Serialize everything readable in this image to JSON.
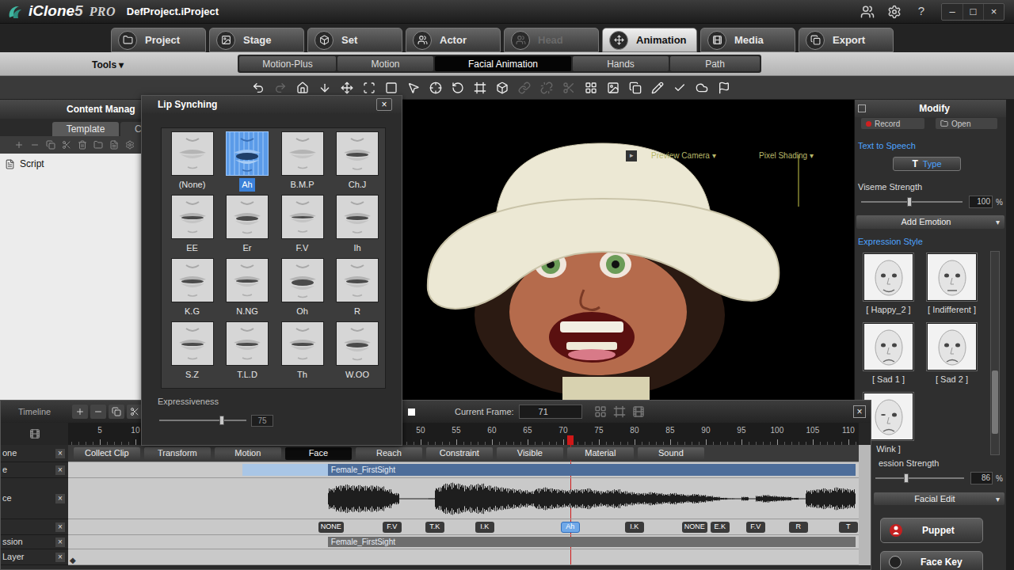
{
  "window": {
    "logo": {
      "name": "iClone",
      "version": "5",
      "edition": "PRO"
    },
    "project": "DefProject.iProject",
    "buttons": [
      "?",
      "–",
      "□",
      "×"
    ]
  },
  "main_tabs": [
    {
      "label": "Project",
      "selected": false,
      "disabled": false
    },
    {
      "label": "Stage",
      "selected": false,
      "disabled": false
    },
    {
      "label": "Set",
      "selected": false,
      "disabled": false
    },
    {
      "label": "Actor",
      "selected": false,
      "disabled": false
    },
    {
      "label": "Head",
      "selected": false,
      "disabled": true
    },
    {
      "label": "Animation",
      "selected": true,
      "disabled": false
    },
    {
      "label": "Media",
      "selected": false,
      "disabled": false
    },
    {
      "label": "Export",
      "selected": false,
      "disabled": false
    }
  ],
  "tools_menu": "Tools ▾",
  "sub_tabs": [
    {
      "label": "Motion-Plus",
      "selected": false
    },
    {
      "label": "Motion",
      "selected": false
    },
    {
      "label": "Facial Animation",
      "selected": true
    },
    {
      "label": "Hands",
      "selected": false
    },
    {
      "label": "Path",
      "selected": false
    }
  ],
  "toolbar": [
    {
      "disabled": false
    },
    {
      "disabled": true
    },
    {
      "disabled": false
    },
    {
      "disabled": false
    },
    {
      "disabled": false
    },
    {
      "disabled": false
    },
    {
      "disabled": false
    },
    {
      "disabled": false
    },
    {
      "disabled": false
    },
    {
      "disabled": false
    },
    {
      "disabled": false
    },
    {
      "disabled": false
    },
    {
      "disabled": true
    },
    {
      "disabled": true
    },
    {
      "disabled": true
    },
    {
      "disabled": false
    },
    {
      "disabled": false
    },
    {
      "disabled": false
    },
    {
      "disabled": false
    },
    {
      "disabled": false
    },
    {
      "disabled": false
    },
    {
      "disabled": false
    }
  ],
  "content_manager": {
    "title": "Content Manag",
    "tabs": [
      {
        "label": "Template",
        "selected": true
      },
      {
        "label": "C",
        "selected": false
      }
    ],
    "items": [
      {
        "label": "Script",
        "selected": false
      }
    ]
  },
  "lip_sync": {
    "title": "Lip Synching",
    "close": "×",
    "visemes": [
      {
        "label": "(None)",
        "selected": false
      },
      {
        "label": "Ah",
        "selected": true
      },
      {
        "label": "B.M.P",
        "selected": false
      },
      {
        "label": "Ch.J",
        "selected": false
      },
      {
        "label": "EE",
        "selected": false
      },
      {
        "label": "Er",
        "selected": false
      },
      {
        "label": "F.V",
        "selected": false
      },
      {
        "label": "Ih",
        "selected": false
      },
      {
        "label": "K.G",
        "selected": false
      },
      {
        "label": "N.NG",
        "selected": false
      },
      {
        "label": "Oh",
        "selected": false
      },
      {
        "label": "R",
        "selected": false
      },
      {
        "label": "S.Z",
        "selected": false
      },
      {
        "label": "T.L.D",
        "selected": false
      },
      {
        "label": "Th",
        "selected": false
      },
      {
        "label": "W.OO",
        "selected": false
      }
    ],
    "expressiveness": {
      "label": "Expressiveness",
      "level": 0.72,
      "value": "75"
    }
  },
  "viewport": {
    "arrow": "▸",
    "camera": "Preview Camera ▾",
    "shading": "Pixel Shading ▾"
  },
  "modify": {
    "title": "Modify",
    "record": "Record",
    "open": "Open",
    "text_to_speech": "Text to Speech",
    "type_icon": "T",
    "type": "Type",
    "viseme_strength": {
      "label": "Viseme Strength",
      "level": 0.48,
      "value": "100",
      "unit": "%"
    },
    "add_emotion": "Add Emotion",
    "dropdown_glyph": "▾",
    "expression_style": "Expression Style",
    "expressions": [
      {
        "label": "[ Happy_2 ]",
        "selected": false
      },
      {
        "label": "[ Indifferent ]",
        "selected": false
      },
      {
        "label": "[ Sad 1 ]",
        "selected": false
      },
      {
        "label": "[ Sad 2 ]",
        "selected": false
      },
      {
        "label": "Wink ]",
        "selected": false
      }
    ],
    "expression_strength": {
      "label": "ession Strength",
      "level": 0.35,
      "value": "86",
      "unit": "%"
    },
    "facial_edit": "Facial Edit",
    "puppet": "Puppet",
    "face_key": "Face Key"
  },
  "timeline": {
    "title": "Timeline",
    "current_frame_label": "Current Frame:",
    "current_frame": "71",
    "close": "×",
    "ticks": [
      "5",
      "10",
      "50",
      "55",
      "60",
      "65",
      "70",
      "75",
      "80",
      "85",
      "90",
      "95",
      "100",
      "105",
      "110"
    ],
    "tracks": [
      {
        "label": "one",
        "kind": "buttons",
        "buttons": [
          {
            "label": "Collect Clip",
            "selected": false
          },
          {
            "label": "Transform",
            "selected": false
          },
          {
            "label": "Motion",
            "selected": false
          },
          {
            "label": "Face",
            "selected": true
          },
          {
            "label": "Reach",
            "selected": false
          },
          {
            "label": "Constraint",
            "selected": false
          },
          {
            "label": "Visible",
            "selected": false
          },
          {
            "label": "Material",
            "selected": false
          },
          {
            "label": "Sound",
            "selected": false
          }
        ]
      },
      {
        "label": "e",
        "kind": "clip",
        "range_start": 25,
        "clip": {
          "label": "Female_FirstSight",
          "start": 37,
          "end": 111,
          "color": "#4d6d9a"
        }
      },
      {
        "label": "ce",
        "kind": "wave",
        "start": 37,
        "levels": [
          0.55,
          0.7,
          0.75,
          0.7,
          0.72,
          0.68,
          0.7,
          0.65,
          0.5,
          0.3,
          0.02,
          0.02,
          0.02,
          0.02,
          0.03,
          0.6,
          0.8,
          0.85,
          0.8,
          0.7,
          0.75,
          0.8,
          0.7,
          0.65,
          0.6,
          0.55,
          0.5,
          0.45,
          0.4,
          0.55,
          0.6,
          0.55,
          0.5,
          0.45,
          0.5,
          0.5,
          0.55,
          0.45,
          0.4,
          0.45,
          0.5,
          0.4,
          0.35,
          0.3,
          0.3,
          0.35,
          0.3,
          0.25,
          0.3,
          0.25,
          0.2,
          0.25,
          0.2,
          0.15,
          0.1,
          0.05,
          0.03,
          0.02,
          0.1,
          0.02,
          0.15,
          0.2,
          0.15,
          0.12,
          0.1,
          0.05,
          0.02,
          0.45,
          0.5,
          0.55,
          0.5,
          0.6,
          0.55,
          0.5
        ]
      },
      {
        "label": "",
        "kind": "keys",
        "keys": [
          {
            "label": "NONE",
            "frame": 37,
            "selected": false
          },
          {
            "label": "F.V",
            "frame": 46,
            "selected": false
          },
          {
            "label": "T.K",
            "frame": 52,
            "selected": false
          },
          {
            "label": "I.K",
            "frame": 59,
            "selected": false
          },
          {
            "label": "Ah",
            "frame": 71,
            "selected": true
          },
          {
            "label": "I.K",
            "frame": 80,
            "selected": false
          },
          {
            "label": "NONE",
            "frame": 88,
            "selected": false
          },
          {
            "label": "E.K",
            "frame": 92,
            "selected": false
          },
          {
            "label": "F.V",
            "frame": 97,
            "selected": false
          },
          {
            "label": "R",
            "frame": 103,
            "selected": false
          },
          {
            "label": "T",
            "frame": 110,
            "selected": false
          }
        ]
      },
      {
        "label": "ssion",
        "kind": "clip",
        "clip": {
          "label": "Female_FirstSight",
          "start": 37,
          "end": 111,
          "color": "#6e6e6e"
        }
      },
      {
        "label": "Layer",
        "kind": "layer",
        "marker": "◆"
      }
    ]
  }
}
